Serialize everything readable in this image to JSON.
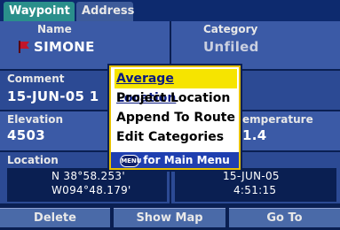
{
  "tabs": [
    {
      "label": "Waypoint"
    },
    {
      "label": "Address"
    }
  ],
  "name": {
    "label": "Name",
    "value": "SIMONE"
  },
  "category": {
    "label": "Category",
    "value": "Unfiled"
  },
  "comment": {
    "label": "Comment",
    "value": "15-JUN-05 1"
  },
  "elevation": {
    "label": "Elevation",
    "value": "4503"
  },
  "temperature": {
    "label": "emperature",
    "value": "1.4"
  },
  "location": {
    "label": "Location",
    "lat": "N  38°58.253'",
    "lon": "W094°48.179'"
  },
  "datetime": {
    "date": "15-JUN-05",
    "time": "4:51:15"
  },
  "menu": {
    "items": [
      "Average Location",
      "Project Location",
      "Append To Route",
      "Edit Categories"
    ],
    "selected_index": 0,
    "footer_button": "MENU",
    "footer_text": "for Main Menu"
  },
  "buttons": {
    "delete": "Delete",
    "show_map": "Show Map",
    "go_to": "Go To"
  },
  "colors": {
    "active_tab": "#2a8f8b",
    "menu_highlight": "#f6e400",
    "flag": "#c0152b"
  }
}
